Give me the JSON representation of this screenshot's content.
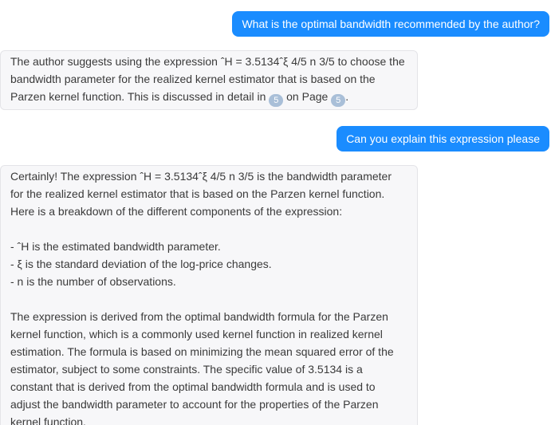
{
  "messages": {
    "q1": "What is the optimal bandwidth recommended by the author?",
    "a1": {
      "text_before": "The author suggests using the expression ˆH = 3.5134ˆξ 4/5 n 3/5 to choose the bandwidth parameter for the realized kernel estimator that is based on the Parzen kernel function. This is discussed in detail in ",
      "cite1": "5",
      "text_middle": " on Page ",
      "cite2": "5",
      "text_after": "."
    },
    "q2": "Can you explain this expression please",
    "a2": {
      "intro": "Certainly! The expression ˆH = 3.5134ˆξ 4/5 n 3/5 is the bandwidth parameter for the realized kernel estimator that is based on the Parzen kernel function. Here is a breakdown of the different components of the expression:",
      "bullets": [
        "- ˆH is the estimated bandwidth parameter.",
        "- ξ is the standard deviation of the log-price changes.",
        "- n is the number of observations."
      ],
      "explanation": "The expression is derived from the optimal bandwidth formula for the Parzen kernel function, which is a commonly used kernel function in realized kernel estimation. The formula is based on minimizing the mean squared error of the estimator, subject to some constraints. The specific value of 3.5134 is a constant that is derived from the optimal bandwidth formula and is used to adjust the bandwidth parameter to account for the properties of the Parzen kernel function."
    }
  },
  "colors": {
    "user_bubble": "#1a8cff",
    "bot_bubble": "#f7f7f9",
    "citation_badge": "#a9bfd8"
  }
}
